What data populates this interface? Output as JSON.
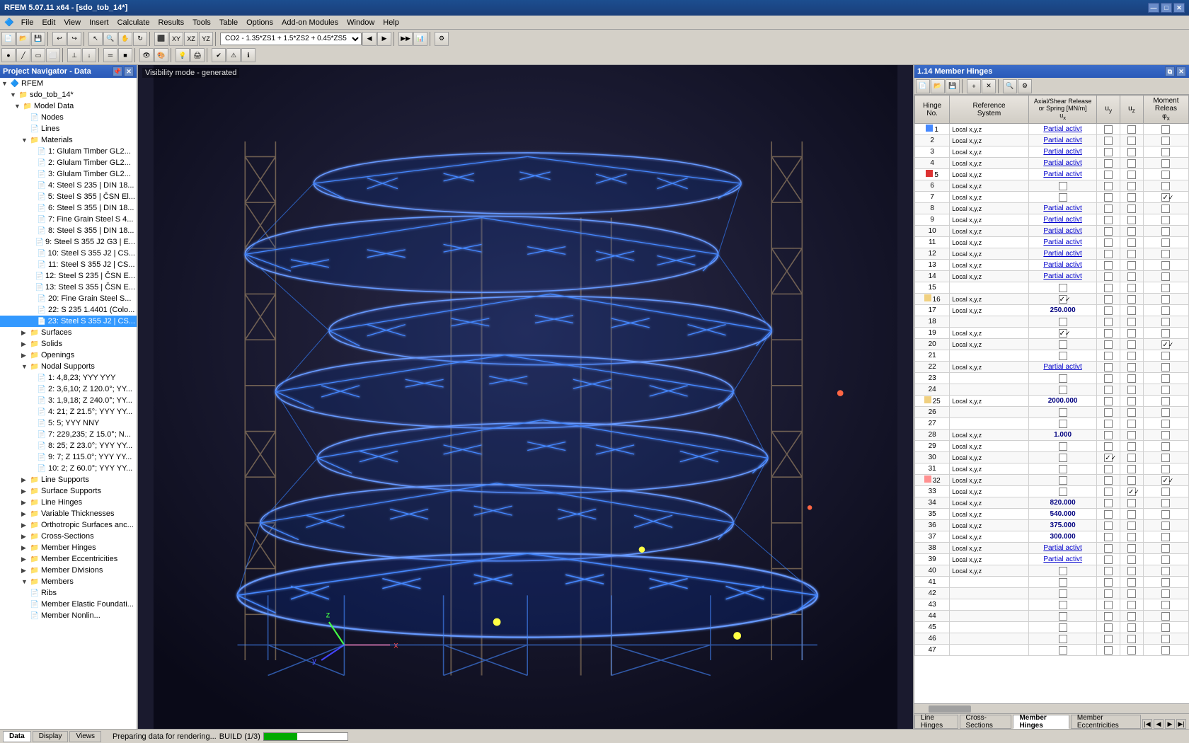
{
  "titleBar": {
    "title": "RFEM 5.07.11 x64 - [sdo_tob_14*]",
    "buttons": [
      "—",
      "□",
      "✕"
    ]
  },
  "menuBar": {
    "items": [
      "File",
      "Edit",
      "View",
      "Insert",
      "Calculate",
      "Results",
      "Tools",
      "Table",
      "Options",
      "Add-on Modules",
      "Window",
      "Help"
    ]
  },
  "toolbar": {
    "combo": "CO2 - 1.35*ZS1 + 1.5*ZS2 + 0.45*ZS5"
  },
  "leftPanel": {
    "title": "Project Navigator - Data",
    "tree": {
      "root": "RFEM",
      "project": "sdo_tob_14*",
      "items": [
        {
          "label": "Model Data",
          "level": 2,
          "type": "folder",
          "expanded": true
        },
        {
          "label": "Nodes",
          "level": 3,
          "type": "item"
        },
        {
          "label": "Lines",
          "level": 3,
          "type": "item"
        },
        {
          "label": "Materials",
          "level": 3,
          "type": "folder",
          "expanded": true
        },
        {
          "label": "1: Glulam Timber GL2...",
          "level": 4,
          "type": "item"
        },
        {
          "label": "2: Glulam Timber GL2...",
          "level": 4,
          "type": "item"
        },
        {
          "label": "3: Glulam Timber GL2...",
          "level": 4,
          "type": "item"
        },
        {
          "label": "4: Steel S 235 | DIN 18...",
          "level": 4,
          "type": "item"
        },
        {
          "label": "5: Steel S 355 | ČSN El...",
          "level": 4,
          "type": "item"
        },
        {
          "label": "6: Steel S 355 | DIN 18...",
          "level": 4,
          "type": "item"
        },
        {
          "label": "7: Fine Grain Steel S 4...",
          "level": 4,
          "type": "item"
        },
        {
          "label": "8: Steel S 355 | DIN 18...",
          "level": 4,
          "type": "item"
        },
        {
          "label": "9: Steel S 355 J2 G3 | E...",
          "level": 4,
          "type": "item"
        },
        {
          "label": "10: Steel S 355 J2 | CS...",
          "level": 4,
          "type": "item"
        },
        {
          "label": "11: Steel S 355 J2 | CS...",
          "level": 4,
          "type": "item"
        },
        {
          "label": "12: Steel S 235 | ČSN E...",
          "level": 4,
          "type": "item"
        },
        {
          "label": "13: Steel S 355 | ČSN E...",
          "level": 4,
          "type": "item"
        },
        {
          "label": "20: Fine Grain Steel S...",
          "level": 4,
          "type": "item"
        },
        {
          "label": "22: S 235 1.4401 (Colo...",
          "level": 4,
          "type": "item"
        },
        {
          "label": "23: Steel S 355 J2 | CS...",
          "level": 4,
          "type": "item",
          "selected": true
        },
        {
          "label": "Surfaces",
          "level": 3,
          "type": "folder"
        },
        {
          "label": "Solids",
          "level": 3,
          "type": "folder"
        },
        {
          "label": "Openings",
          "level": 3,
          "type": "folder"
        },
        {
          "label": "Nodal Supports",
          "level": 3,
          "type": "folder",
          "expanded": true
        },
        {
          "label": "1: 4,8,23; YYY YYY",
          "level": 4,
          "type": "item"
        },
        {
          "label": "2: 3,6,10; Z 120.0°; YY...",
          "level": 4,
          "type": "item"
        },
        {
          "label": "3: 1,9,18; Z 240.0°; YY...",
          "level": 4,
          "type": "item"
        },
        {
          "label": "4: 21; Z 21.5°; YYY YY...",
          "level": 4,
          "type": "item"
        },
        {
          "label": "5: 5; YYY NNY",
          "level": 4,
          "type": "item"
        },
        {
          "label": "7: 229,235; Z 15.0°; N...",
          "level": 4,
          "type": "item"
        },
        {
          "label": "8: 25; Z 23.0°; YYY YY...",
          "level": 4,
          "type": "item"
        },
        {
          "label": "9: 7; Z 115.0°; YYY YY...",
          "level": 4,
          "type": "item"
        },
        {
          "label": "10: 2; Z 60.0°; YYY YY...",
          "level": 4,
          "type": "item"
        },
        {
          "label": "Line Supports",
          "level": 3,
          "type": "folder"
        },
        {
          "label": "Surface Supports",
          "level": 3,
          "type": "folder"
        },
        {
          "label": "Line Hinges",
          "level": 3,
          "type": "folder"
        },
        {
          "label": "Variable Thicknesses",
          "level": 3,
          "type": "folder"
        },
        {
          "label": "Orthotropic Surfaces anc...",
          "level": 3,
          "type": "folder"
        },
        {
          "label": "Cross-Sections",
          "level": 3,
          "type": "folder"
        },
        {
          "label": "Member Hinges",
          "level": 3,
          "type": "folder"
        },
        {
          "label": "Member Eccentricities",
          "level": 3,
          "type": "folder"
        },
        {
          "label": "Member Divisions",
          "level": 3,
          "type": "folder"
        },
        {
          "label": "Members",
          "level": 3,
          "type": "folder",
          "expanded": true
        },
        {
          "label": "Ribs",
          "level": 3,
          "type": "item"
        },
        {
          "label": "Member Elastic Foundati...",
          "level": 3,
          "type": "item"
        },
        {
          "label": "Member Nonlin...",
          "level": 3,
          "type": "item"
        }
      ]
    }
  },
  "viewport": {
    "label": "Visibility mode - generated",
    "background": "#1a1a2e"
  },
  "rightPanel": {
    "title": "1.14 Member Hinges",
    "columns": [
      "Hinge No.",
      "Reference System",
      "Axial/Shear Release or Spring [MN/m]\nux",
      "uy",
      "uz",
      "Moment Releas\nφx"
    ],
    "rows": [
      {
        "no": 1,
        "color": "blue",
        "ref": "Local x,y,z",
        "ux": "Partial activt",
        "ux_partial": true,
        "uy": false,
        "uz": false,
        "px": false
      },
      {
        "no": 2,
        "color": null,
        "ref": "Local x,y,z",
        "ux": "Partial activt",
        "ux_partial": true,
        "uy": false,
        "uz": false,
        "px": false
      },
      {
        "no": 3,
        "color": null,
        "ref": "Local x,y,z",
        "ux": "Partial activt",
        "ux_partial": true,
        "uy": false,
        "uz": false,
        "px": false
      },
      {
        "no": 4,
        "color": null,
        "ref": "Local x,y,z",
        "ux": "Partial activt",
        "ux_partial": true,
        "uy": false,
        "uz": false,
        "px": false
      },
      {
        "no": 5,
        "color": "red",
        "ref": "Local x,y,z",
        "ux": "Partial activt",
        "ux_partial": true,
        "uy": false,
        "uz": false,
        "px": false
      },
      {
        "no": 6,
        "color": null,
        "ref": "Local x,y,z",
        "ux": "",
        "ux_partial": false,
        "uy": false,
        "uz": false,
        "px": false
      },
      {
        "no": 7,
        "color": null,
        "ref": "Local x,y,z",
        "ux": "",
        "ux_partial": false,
        "uy": false,
        "uz": false,
        "px": true
      },
      {
        "no": 8,
        "color": null,
        "ref": "Local x,y,z",
        "ux": "Partial activt",
        "ux_partial": true,
        "uy": false,
        "uz": false,
        "px": false
      },
      {
        "no": 9,
        "color": null,
        "ref": "Local x,y,z",
        "ux": "Partial activt",
        "ux_partial": true,
        "uy": false,
        "uz": false,
        "px": false
      },
      {
        "no": 10,
        "color": null,
        "ref": "Local x,y,z",
        "ux": "Partial activt",
        "ux_partial": true,
        "uy": false,
        "uz": false,
        "px": false
      },
      {
        "no": 11,
        "color": null,
        "ref": "Local x,y,z",
        "ux": "Partial activt",
        "ux_partial": true,
        "uy": false,
        "uz": false,
        "px": false
      },
      {
        "no": 12,
        "color": null,
        "ref": "Local x,y,z",
        "ux": "Partial activt",
        "ux_partial": true,
        "uy": false,
        "uz": false,
        "px": false
      },
      {
        "no": 13,
        "color": null,
        "ref": "Local x,y,z",
        "ux": "Partial activt",
        "ux_partial": true,
        "uy": false,
        "uz": false,
        "px": false
      },
      {
        "no": 14,
        "color": null,
        "ref": "Local x,y,z",
        "ux": "Partial activt",
        "ux_partial": true,
        "uy": false,
        "uz": false,
        "px": false
      },
      {
        "no": 15,
        "color": null,
        "ref": "",
        "ux": "",
        "ux_partial": false,
        "uy": false,
        "uz": false,
        "px": false
      },
      {
        "no": 16,
        "color": "yellow",
        "ref": "Local x,y,z",
        "ux": "checked",
        "ux_checked": true,
        "uy": false,
        "uz": false,
        "px": false
      },
      {
        "no": 17,
        "color": null,
        "ref": "Local x,y,z",
        "ux": "250.000",
        "ux_num": true,
        "uy": false,
        "uz": false,
        "px": false
      },
      {
        "no": 18,
        "color": null,
        "ref": "",
        "ux": "",
        "ux_partial": false,
        "uy": false,
        "uz": false,
        "px": false
      },
      {
        "no": 19,
        "color": null,
        "ref": "Local x,y,z",
        "ux": "checked",
        "ux_checked": true,
        "uy": false,
        "uz": false,
        "px": false
      },
      {
        "no": 20,
        "color": null,
        "ref": "Local x,y,z",
        "ux": "",
        "ux_partial": false,
        "uy": false,
        "uz": false,
        "px": true
      },
      {
        "no": 21,
        "color": null,
        "ref": "",
        "ux": "",
        "ux_partial": false,
        "uy": false,
        "uz": false,
        "px": false
      },
      {
        "no": 22,
        "color": null,
        "ref": "Local x,y,z",
        "ux": "Partial activt",
        "ux_partial": true,
        "uy": false,
        "uz": false,
        "px": false
      },
      {
        "no": 23,
        "color": null,
        "ref": "",
        "ux": "",
        "uy": false,
        "uz": false,
        "px": false
      },
      {
        "no": 24,
        "color": null,
        "ref": "",
        "ux": "",
        "uy": false,
        "uz": false,
        "px": false
      },
      {
        "no": 25,
        "color": "yellow",
        "ref": "Local x,y,z",
        "ux": "2000.000",
        "ux_num": true,
        "uy": false,
        "uz": false,
        "px": false
      },
      {
        "no": 26,
        "color": null,
        "ref": "",
        "ux": "",
        "uy": false,
        "uz": false,
        "px": false
      },
      {
        "no": 27,
        "color": null,
        "ref": "",
        "ux": "",
        "uy": false,
        "uz": false,
        "px": false
      },
      {
        "no": 28,
        "color": null,
        "ref": "Local x,y,z",
        "ux": "1.000",
        "ux_num": true,
        "uy": false,
        "uz": false,
        "px": false
      },
      {
        "no": 29,
        "color": null,
        "ref": "Local x,y,z",
        "ux": "",
        "uy": false,
        "uz": false,
        "px": false
      },
      {
        "no": 30,
        "color": null,
        "ref": "Local x,y,z",
        "ux": "",
        "uy": true,
        "uz": false,
        "px": false
      },
      {
        "no": 31,
        "color": null,
        "ref": "Local x,y,z",
        "ux": "",
        "uy": false,
        "uz": false,
        "px": false
      },
      {
        "no": 32,
        "color": "pink",
        "ref": "Local x,y,z",
        "ux": "",
        "uy": false,
        "uz": false,
        "px": true
      },
      {
        "no": 33,
        "color": null,
        "ref": "Local x,y,z",
        "ux": "",
        "uy": false,
        "uz": true,
        "px": false
      },
      {
        "no": 34,
        "color": null,
        "ref": "Local x,y,z",
        "ux": "820.000",
        "ux_num": true,
        "uy": false,
        "uz": false,
        "px": false
      },
      {
        "no": 35,
        "color": null,
        "ref": "Local x,y,z",
        "ux": "540.000",
        "ux_num": true,
        "uy": false,
        "uz": false,
        "px": false
      },
      {
        "no": 36,
        "color": null,
        "ref": "Local x,y,z",
        "ux": "375.000",
        "ux_num": true,
        "uy": false,
        "uz": false,
        "px": false
      },
      {
        "no": 37,
        "color": null,
        "ref": "Local x,y,z",
        "ux": "300.000",
        "ux_num": true,
        "uy": false,
        "uz": false,
        "px": false
      },
      {
        "no": 38,
        "color": null,
        "ref": "Local x,y,z",
        "ux": "Partial activt",
        "ux_partial": true,
        "uy": false,
        "uz": false,
        "px": false
      },
      {
        "no": 39,
        "color": null,
        "ref": "Local x,y,z",
        "ux": "Partial activt",
        "ux_partial": true,
        "uy": false,
        "uz": false,
        "px": false
      },
      {
        "no": 40,
        "color": null,
        "ref": "Local x,y,z",
        "ux": "",
        "uy": false,
        "uz": false,
        "px": false
      },
      {
        "no": 41,
        "color": null,
        "ref": "",
        "ux": "",
        "uy": false,
        "uz": false,
        "px": false
      },
      {
        "no": 42,
        "color": null,
        "ref": "",
        "ux": "",
        "uy": false,
        "uz": false,
        "px": false
      },
      {
        "no": 43,
        "color": null,
        "ref": "",
        "ux": "",
        "uy": false,
        "uz": false,
        "px": false
      },
      {
        "no": 44,
        "color": null,
        "ref": "",
        "ux": "",
        "uy": false,
        "uz": false,
        "px": false
      },
      {
        "no": 45,
        "color": null,
        "ref": "",
        "ux": "",
        "uy": false,
        "uz": false,
        "px": false
      },
      {
        "no": 46,
        "color": null,
        "ref": "",
        "ux": "",
        "uy": false,
        "uz": false,
        "px": false
      },
      {
        "no": 47,
        "color": null,
        "ref": "",
        "ux": "",
        "uy": false,
        "uz": false,
        "px": false
      }
    ],
    "tabs": [
      "Line Hinges",
      "Cross-Sections",
      "Member Hinges",
      "Member Eccentricities"
    ]
  },
  "statusBar": {
    "tabs": [
      "Data",
      "Display",
      "Views"
    ],
    "activeTab": "Data",
    "message": "Preparing data for rendering...",
    "buildInfo": "BUILD (1/3)"
  }
}
